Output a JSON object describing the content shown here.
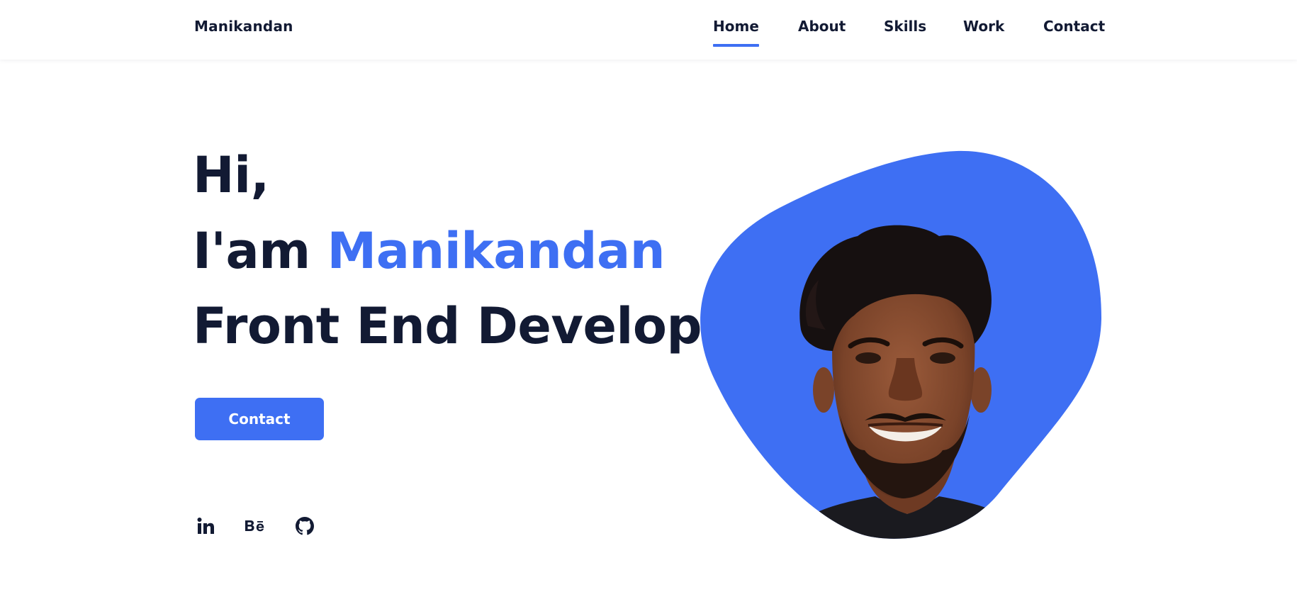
{
  "header": {
    "logo": "Manikandan",
    "nav": [
      {
        "label": "Home",
        "active": true
      },
      {
        "label": "About",
        "active": false
      },
      {
        "label": "Skills",
        "active": false
      },
      {
        "label": "Work",
        "active": false
      },
      {
        "label": "Contact",
        "active": false
      }
    ]
  },
  "hero": {
    "greeting": "Hi,",
    "intro_prefix": "I'am",
    "name": "Manikandan",
    "role": "Front End Developer",
    "cta_label": "Contact",
    "photo_description": "portrait-photo"
  },
  "social": [
    {
      "icon": "linkedin-icon",
      "label": "in"
    },
    {
      "icon": "behance-icon",
      "label": "Bē"
    },
    {
      "icon": "github-icon",
      "label": ""
    }
  ],
  "colors": {
    "accent": "#3e6ff3",
    "text": "#121a33",
    "background": "#ffffff"
  }
}
